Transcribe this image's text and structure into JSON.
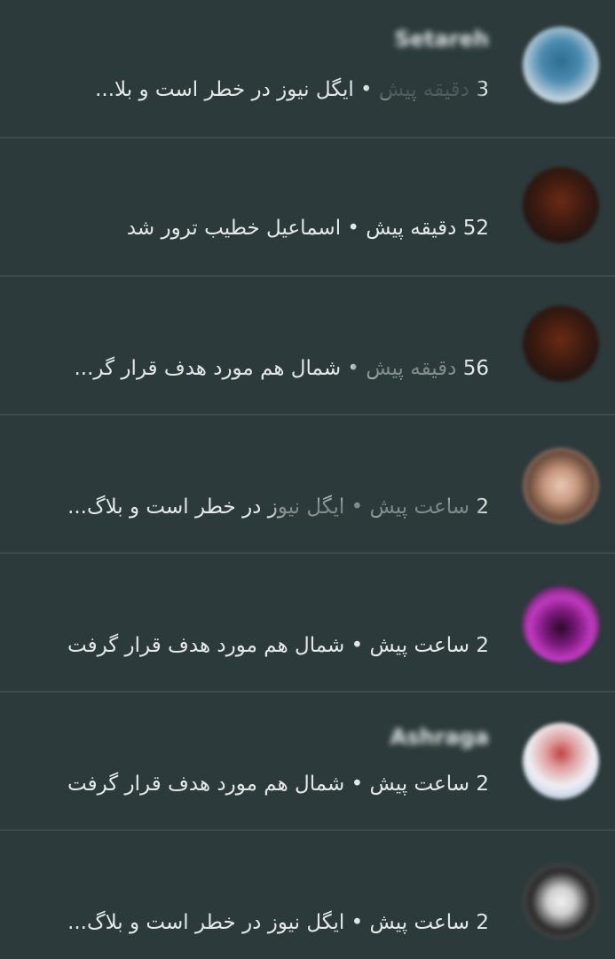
{
  "colors": {
    "background": "#2c3a3b",
    "divider": "#3c4b4c",
    "text": "#e4e7e8"
  },
  "notifications": [
    {
      "name": "Setareh",
      "subtitle": "3 دقیقه پیش • ایگل نیوز در خطر است و بلا...",
      "avatar_icon": "profile-photo"
    },
    {
      "name": "",
      "subtitle": "52 دقیقه پیش • اسماعیل خطیب ترور شد",
      "avatar_icon": "profile-photo"
    },
    {
      "name": "",
      "subtitle": "56 دقیقه پیش • شمال هم مورد هدف قرار گر...",
      "avatar_icon": "profile-photo"
    },
    {
      "name": "",
      "subtitle": "2 ساعت پیش • ایگل نیوز در خطر است و بلاگ...",
      "avatar_icon": "profile-photo"
    },
    {
      "name": "",
      "subtitle": "2 ساعت پیش • شمال هم مورد هدف قرار گرفت",
      "avatar_icon": "profile-photo"
    },
    {
      "name": "Ashraga",
      "subtitle": "2 ساعت پیش • شمال هم مورد هدف قرار گرفت",
      "avatar_icon": "profile-photo"
    },
    {
      "name": "",
      "subtitle": "2 ساعت پیش • ایگل نیوز در خطر است و بلاگ...",
      "avatar_icon": "profile-photo"
    }
  ]
}
